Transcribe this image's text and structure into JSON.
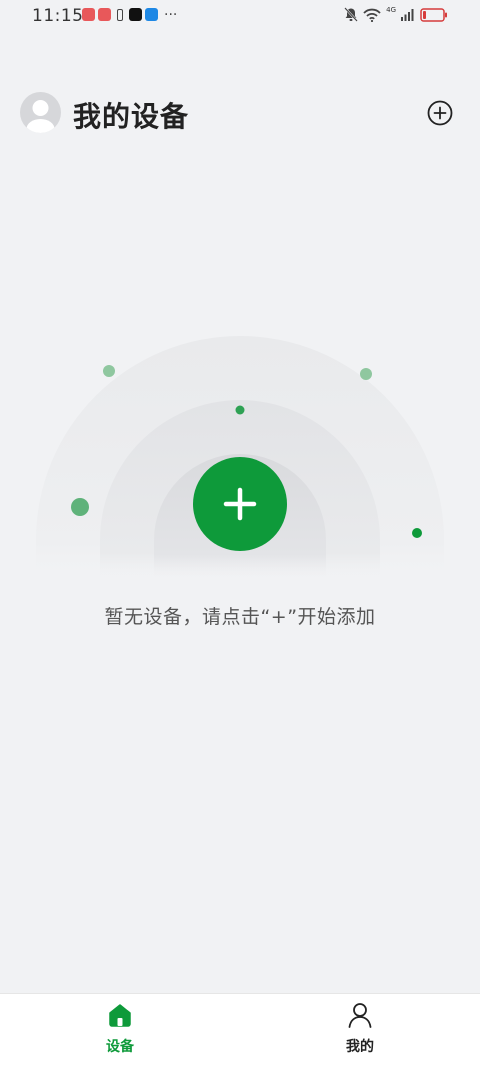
{
  "status_bar": {
    "time": "11:15",
    "network_label": "4G"
  },
  "header": {
    "title": "我的设备"
  },
  "empty_state": {
    "message": "暂无设备，请点击“+”开始添加"
  },
  "bottom_nav": {
    "items": [
      {
        "label": "设备",
        "icon": "home-icon",
        "active": true
      },
      {
        "label": "我的",
        "icon": "person-icon",
        "active": false
      }
    ]
  },
  "colors": {
    "accent": "#0e9a3a",
    "background": "#f1f2f4"
  }
}
